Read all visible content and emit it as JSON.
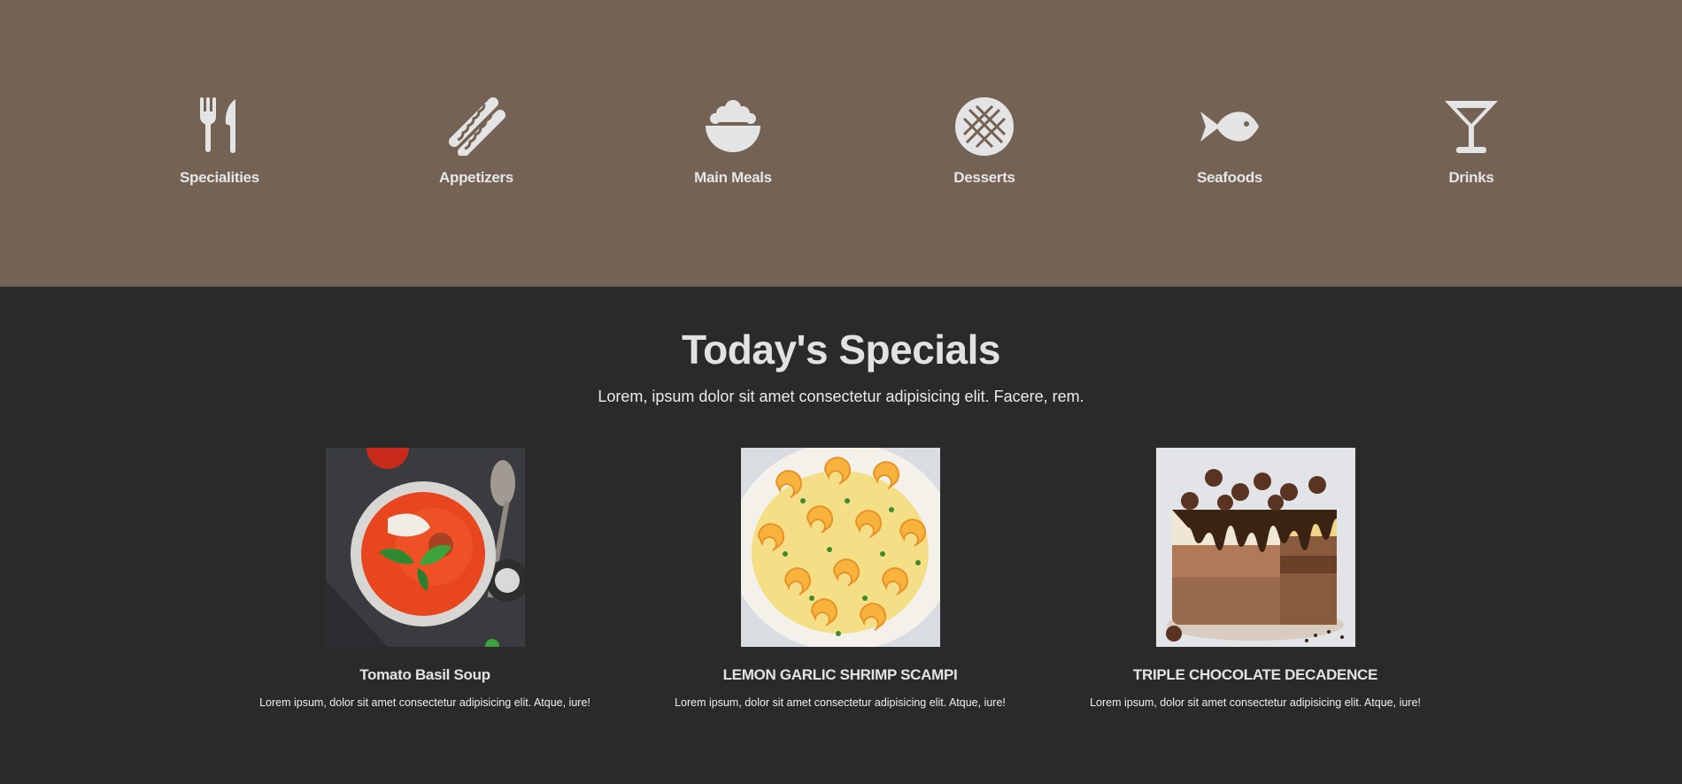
{
  "categories": {
    "items": [
      {
        "label": "Specialities",
        "icon": "utensils-icon"
      },
      {
        "label": "Appetizers",
        "icon": "hotdog-icon"
      },
      {
        "label": "Main Meals",
        "icon": "rice-bowl-icon"
      },
      {
        "label": "Desserts",
        "icon": "pie-icon"
      },
      {
        "label": "Seafoods",
        "icon": "fish-icon"
      },
      {
        "label": "Drinks",
        "icon": "cocktail-icon"
      }
    ]
  },
  "specials": {
    "title": "Today's Specials",
    "subtitle": "Lorem, ipsum dolor sit amet consectetur adipisicing elit. Facere, rem.",
    "items": [
      {
        "name": "Tomato Basil Soup",
        "desc": "Lorem ipsum, dolor sit amet consectetur adipisicing elit. Atque, iure!",
        "image": "tomato-soup-image"
      },
      {
        "name": "LEMON GARLIC SHRIMP SCAMPI",
        "desc": "Lorem ipsum, dolor sit amet consectetur adipisicing elit. Atque, iure!",
        "image": "shrimp-scampi-image"
      },
      {
        "name": "TRIPLE CHOCOLATE DECADENCE",
        "desc": "Lorem ipsum, dolor sit amet consectetur adipisicing elit. Atque, iure!",
        "image": "chocolate-cake-image"
      }
    ]
  },
  "colors": {
    "category_bg": "#746254",
    "page_bg": "#2a2a2a",
    "icon_fill": "#e4e4e4"
  }
}
